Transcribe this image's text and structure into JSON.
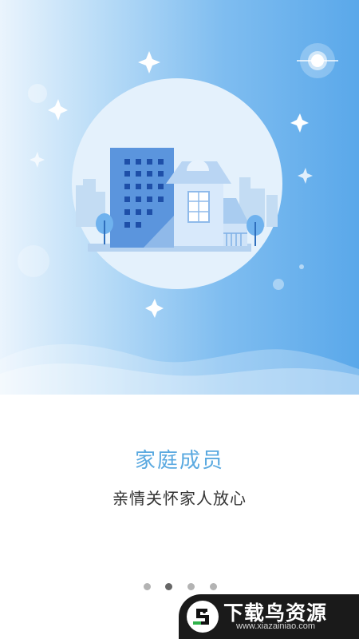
{
  "page": {
    "title": "家庭成员",
    "subtitle": "亲情关怀家人放心"
  },
  "pager": {
    "count": 4,
    "active_index": 1
  },
  "watermark": {
    "name": "下载鸟资源",
    "url": "www.xiazainiao.com",
    "icon": "bird-logo-icon"
  },
  "colors": {
    "accent": "#5aa9e0",
    "hero_start": "#eaf4fd",
    "hero_end": "#5aa8ea"
  }
}
